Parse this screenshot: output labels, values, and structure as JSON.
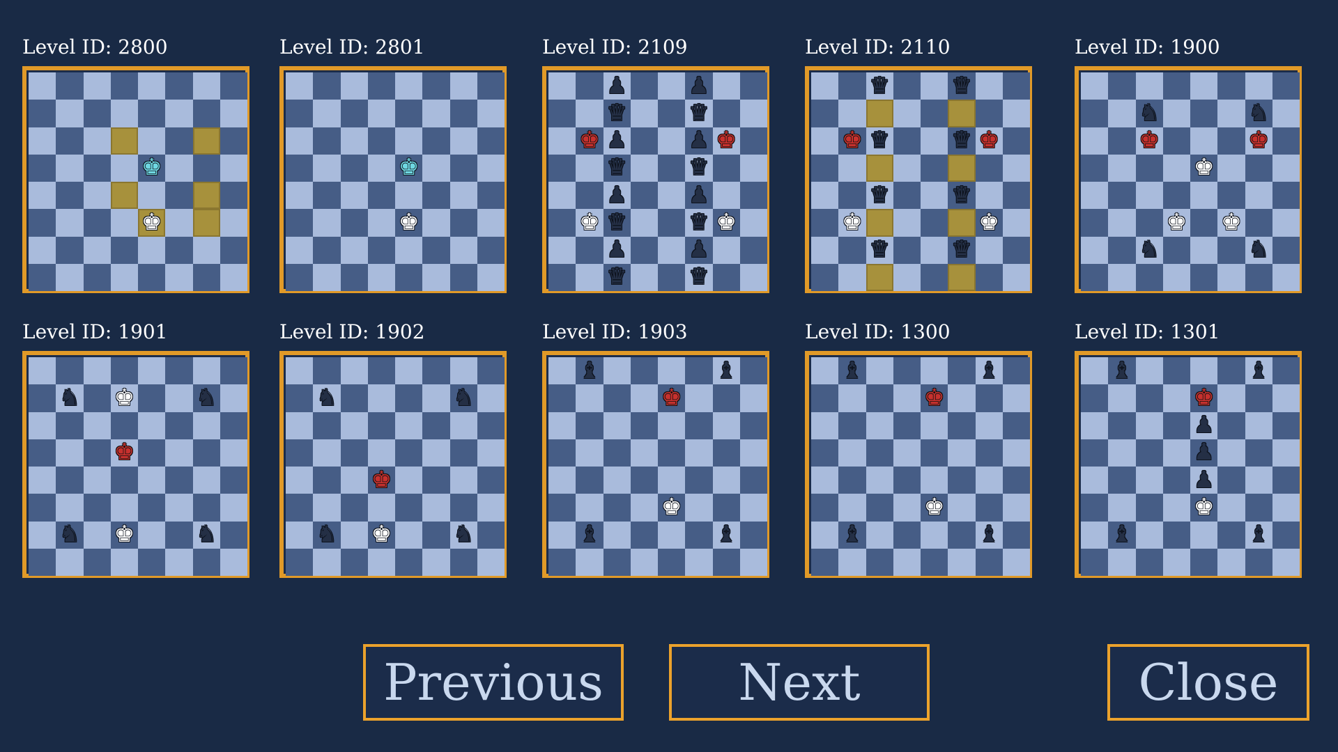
{
  "colors": {
    "background": "#192a45",
    "board_border": "#e19a28",
    "light_square": "#a9bbdc",
    "dark_square": "#465d86",
    "highlight_square": "#a7913c",
    "button_border": "#eba22c",
    "button_text": "#c9d8ee"
  },
  "piece_glyphs": {
    "K": "♚",
    "Q": "♛",
    "N": "♞",
    "B": "♝",
    "P": "♟"
  },
  "piece_colors": {
    "w": "white",
    "b": "black",
    "r": "red",
    "c": "cyan"
  },
  "levels": [
    {
      "label": "Level ID: 2800",
      "highlights": [
        "d6",
        "g6",
        "d4",
        "g4",
        "e3",
        "g3"
      ],
      "pieces": [
        {
          "sq": "e5",
          "type": "K",
          "color": "c"
        },
        {
          "sq": "e3",
          "type": "K",
          "color": "w"
        }
      ]
    },
    {
      "label": "Level ID: 2801",
      "highlights": [],
      "pieces": [
        {
          "sq": "e5",
          "type": "K",
          "color": "c"
        },
        {
          "sq": "e3",
          "type": "K",
          "color": "w"
        }
      ]
    },
    {
      "label": "Level ID: 2109",
      "highlights": [],
      "pieces": [
        {
          "sq": "c8",
          "type": "P",
          "color": "b"
        },
        {
          "sq": "f8",
          "type": "P",
          "color": "b"
        },
        {
          "sq": "c7",
          "type": "Q",
          "color": "b"
        },
        {
          "sq": "f7",
          "type": "Q",
          "color": "b"
        },
        {
          "sq": "b6",
          "type": "K",
          "color": "r"
        },
        {
          "sq": "c6",
          "type": "P",
          "color": "b"
        },
        {
          "sq": "f6",
          "type": "P",
          "color": "b"
        },
        {
          "sq": "g6",
          "type": "K",
          "color": "r"
        },
        {
          "sq": "c5",
          "type": "Q",
          "color": "b"
        },
        {
          "sq": "f5",
          "type": "Q",
          "color": "b"
        },
        {
          "sq": "c4",
          "type": "P",
          "color": "b"
        },
        {
          "sq": "f4",
          "type": "P",
          "color": "b"
        },
        {
          "sq": "b3",
          "type": "K",
          "color": "w"
        },
        {
          "sq": "c3",
          "type": "Q",
          "color": "b"
        },
        {
          "sq": "f3",
          "type": "Q",
          "color": "b"
        },
        {
          "sq": "g3",
          "type": "K",
          "color": "w"
        },
        {
          "sq": "c2",
          "type": "P",
          "color": "b"
        },
        {
          "sq": "f2",
          "type": "P",
          "color": "b"
        },
        {
          "sq": "c1",
          "type": "Q",
          "color": "b"
        },
        {
          "sq": "f1",
          "type": "Q",
          "color": "b"
        }
      ]
    },
    {
      "label": "Level ID: 2110",
      "highlights": [
        "c7",
        "f7",
        "c5",
        "f5",
        "c3",
        "f3",
        "c1",
        "f1"
      ],
      "pieces": [
        {
          "sq": "c8",
          "type": "Q",
          "color": "b"
        },
        {
          "sq": "f8",
          "type": "Q",
          "color": "b"
        },
        {
          "sq": "b6",
          "type": "K",
          "color": "r"
        },
        {
          "sq": "c6",
          "type": "Q",
          "color": "b"
        },
        {
          "sq": "f6",
          "type": "Q",
          "color": "b"
        },
        {
          "sq": "g6",
          "type": "K",
          "color": "r"
        },
        {
          "sq": "c4",
          "type": "Q",
          "color": "b"
        },
        {
          "sq": "f4",
          "type": "Q",
          "color": "b"
        },
        {
          "sq": "b3",
          "type": "K",
          "color": "w"
        },
        {
          "sq": "g3",
          "type": "K",
          "color": "w"
        },
        {
          "sq": "c2",
          "type": "Q",
          "color": "b"
        },
        {
          "sq": "f2",
          "type": "Q",
          "color": "b"
        }
      ]
    },
    {
      "label": "Level ID: 1900",
      "highlights": [],
      "pieces": [
        {
          "sq": "c7",
          "type": "N",
          "color": "b"
        },
        {
          "sq": "g7",
          "type": "N",
          "color": "b"
        },
        {
          "sq": "c6",
          "type": "K",
          "color": "r"
        },
        {
          "sq": "g6",
          "type": "K",
          "color": "r"
        },
        {
          "sq": "e5",
          "type": "K",
          "color": "w"
        },
        {
          "sq": "d3",
          "type": "K",
          "color": "w"
        },
        {
          "sq": "f3",
          "type": "K",
          "color": "w"
        },
        {
          "sq": "c2",
          "type": "N",
          "color": "b"
        },
        {
          "sq": "g2",
          "type": "N",
          "color": "b"
        }
      ]
    },
    {
      "label": "Level ID: 1901",
      "highlights": [],
      "pieces": [
        {
          "sq": "b7",
          "type": "N",
          "color": "b"
        },
        {
          "sq": "d7",
          "type": "K",
          "color": "w"
        },
        {
          "sq": "g7",
          "type": "N",
          "color": "b"
        },
        {
          "sq": "d5",
          "type": "K",
          "color": "r"
        },
        {
          "sq": "b2",
          "type": "N",
          "color": "b"
        },
        {
          "sq": "d2",
          "type": "K",
          "color": "w"
        },
        {
          "sq": "g2",
          "type": "N",
          "color": "b"
        }
      ]
    },
    {
      "label": "Level ID: 1902",
      "highlights": [],
      "pieces": [
        {
          "sq": "b7",
          "type": "N",
          "color": "b"
        },
        {
          "sq": "g7",
          "type": "N",
          "color": "b"
        },
        {
          "sq": "d4",
          "type": "K",
          "color": "r"
        },
        {
          "sq": "b2",
          "type": "N",
          "color": "b"
        },
        {
          "sq": "d2",
          "type": "K",
          "color": "w"
        },
        {
          "sq": "g2",
          "type": "N",
          "color": "b"
        }
      ]
    },
    {
      "label": "Level ID: 1903",
      "highlights": [],
      "pieces": [
        {
          "sq": "b8",
          "type": "B",
          "color": "b"
        },
        {
          "sq": "g8",
          "type": "B",
          "color": "b"
        },
        {
          "sq": "e7",
          "type": "K",
          "color": "r"
        },
        {
          "sq": "e3",
          "type": "K",
          "color": "w"
        },
        {
          "sq": "b2",
          "type": "B",
          "color": "b"
        },
        {
          "sq": "g2",
          "type": "B",
          "color": "b"
        }
      ]
    },
    {
      "label": "Level ID: 1300",
      "highlights": [],
      "pieces": [
        {
          "sq": "b8",
          "type": "B",
          "color": "b"
        },
        {
          "sq": "g8",
          "type": "B",
          "color": "b"
        },
        {
          "sq": "e7",
          "type": "K",
          "color": "r"
        },
        {
          "sq": "e3",
          "type": "K",
          "color": "w"
        },
        {
          "sq": "b2",
          "type": "B",
          "color": "b"
        },
        {
          "sq": "g2",
          "type": "B",
          "color": "b"
        }
      ]
    },
    {
      "label": "Level ID: 1301",
      "highlights": [],
      "pieces": [
        {
          "sq": "b8",
          "type": "B",
          "color": "b"
        },
        {
          "sq": "g8",
          "type": "B",
          "color": "b"
        },
        {
          "sq": "e7",
          "type": "K",
          "color": "r"
        },
        {
          "sq": "e6",
          "type": "P",
          "color": "b"
        },
        {
          "sq": "e5",
          "type": "P",
          "color": "b"
        },
        {
          "sq": "e4",
          "type": "P",
          "color": "b"
        },
        {
          "sq": "e3",
          "type": "K",
          "color": "w"
        },
        {
          "sq": "b2",
          "type": "B",
          "color": "b"
        },
        {
          "sq": "g2",
          "type": "B",
          "color": "b"
        }
      ]
    }
  ],
  "buttons": {
    "previous": "Previous",
    "next": "Next",
    "close": "Close"
  }
}
